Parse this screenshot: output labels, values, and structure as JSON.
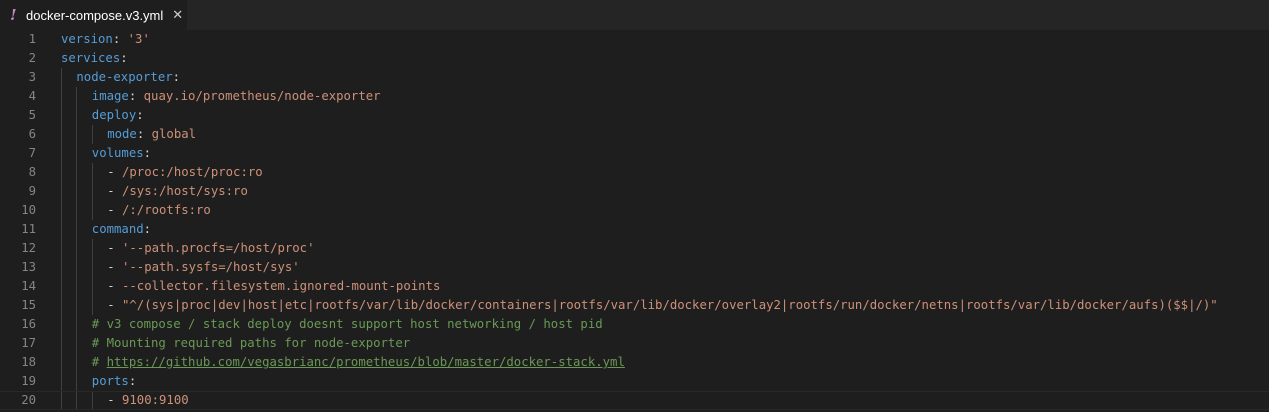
{
  "tab": {
    "title": "docker-compose.v3.yml",
    "icon": "!",
    "close_glyph": "✕"
  },
  "lines": [
    {
      "n": "1",
      "indent": 0,
      "parts": [
        [
          "k",
          "version"
        ],
        [
          "p",
          ": "
        ],
        [
          "s",
          "'3'"
        ]
      ]
    },
    {
      "n": "2",
      "indent": 0,
      "parts": [
        [
          "k",
          "services"
        ],
        [
          "p",
          ":"
        ]
      ]
    },
    {
      "n": "3",
      "indent": 1,
      "parts": [
        [
          "k",
          "node-exporter"
        ],
        [
          "p",
          ":"
        ]
      ]
    },
    {
      "n": "4",
      "indent": 2,
      "parts": [
        [
          "k",
          "image"
        ],
        [
          "p",
          ": "
        ],
        [
          "s",
          "quay.io/prometheus/node-exporter"
        ]
      ]
    },
    {
      "n": "5",
      "indent": 2,
      "parts": [
        [
          "k",
          "deploy"
        ],
        [
          "p",
          ":"
        ]
      ]
    },
    {
      "n": "6",
      "indent": 3,
      "parts": [
        [
          "k",
          "mode"
        ],
        [
          "p",
          ": "
        ],
        [
          "s",
          "global"
        ]
      ]
    },
    {
      "n": "7",
      "indent": 2,
      "parts": [
        [
          "k",
          "volumes"
        ],
        [
          "p",
          ":"
        ]
      ]
    },
    {
      "n": "8",
      "indent": 3,
      "parts": [
        [
          "p",
          "- "
        ],
        [
          "s",
          "/proc:/host/proc:ro"
        ]
      ]
    },
    {
      "n": "9",
      "indent": 3,
      "parts": [
        [
          "p",
          "- "
        ],
        [
          "s",
          "/sys:/host/sys:ro"
        ]
      ]
    },
    {
      "n": "10",
      "indent": 3,
      "parts": [
        [
          "p",
          "- "
        ],
        [
          "s",
          "/:/rootfs:ro"
        ]
      ]
    },
    {
      "n": "11",
      "indent": 2,
      "parts": [
        [
          "k",
          "command"
        ],
        [
          "p",
          ":"
        ]
      ]
    },
    {
      "n": "12",
      "indent": 3,
      "parts": [
        [
          "p",
          "- "
        ],
        [
          "s",
          "'--path.procfs=/host/proc'"
        ]
      ]
    },
    {
      "n": "13",
      "indent": 3,
      "parts": [
        [
          "p",
          "- "
        ],
        [
          "s",
          "'--path.sysfs=/host/sys'"
        ]
      ]
    },
    {
      "n": "14",
      "indent": 3,
      "parts": [
        [
          "p",
          "- "
        ],
        [
          "s",
          "--collector.filesystem.ignored-mount-points"
        ]
      ]
    },
    {
      "n": "15",
      "indent": 3,
      "parts": [
        [
          "p",
          "- "
        ],
        [
          "s",
          "\"^/(sys|proc|dev|host|etc|rootfs/var/lib/docker/containers|rootfs/var/lib/docker/overlay2|rootfs/run/docker/netns|rootfs/var/lib/docker/aufs)($$|/)\""
        ]
      ]
    },
    {
      "n": "16",
      "indent": 2,
      "parts": [
        [
          "c",
          "# v3 compose / stack deploy doesnt support host networking / host pid"
        ]
      ]
    },
    {
      "n": "17",
      "indent": 2,
      "parts": [
        [
          "c",
          "# Mounting required paths for node-exporter"
        ]
      ]
    },
    {
      "n": "18",
      "indent": 2,
      "parts": [
        [
          "c",
          "# "
        ],
        [
          "u",
          "https://github.com/vegasbrianc/prometheus/blob/master/docker-stack.yml"
        ]
      ]
    },
    {
      "n": "19",
      "indent": 2,
      "parts": [
        [
          "k",
          "ports"
        ],
        [
          "p",
          ":"
        ]
      ]
    },
    {
      "n": "20",
      "indent": 3,
      "parts": [
        [
          "p",
          "- "
        ],
        [
          "s",
          "9100:9100"
        ]
      ],
      "current": true
    }
  ]
}
